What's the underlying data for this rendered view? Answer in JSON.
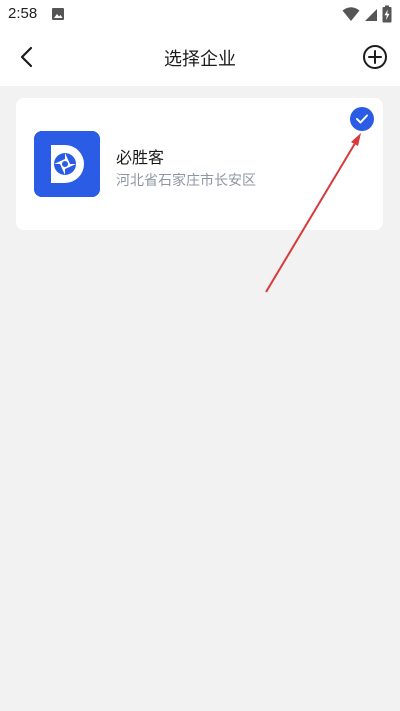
{
  "status_bar": {
    "time": "2:58"
  },
  "header": {
    "title": "选择企业",
    "back_icon": "chevron-left-icon",
    "add_icon": "plus-circle-icon"
  },
  "company": {
    "name": "必胜客",
    "address": "河北省石家庄市长安区",
    "selected": true
  },
  "colors": {
    "accent": "#2b5ce6",
    "annotation": "#d9393a",
    "background": "#f2f2f2"
  }
}
